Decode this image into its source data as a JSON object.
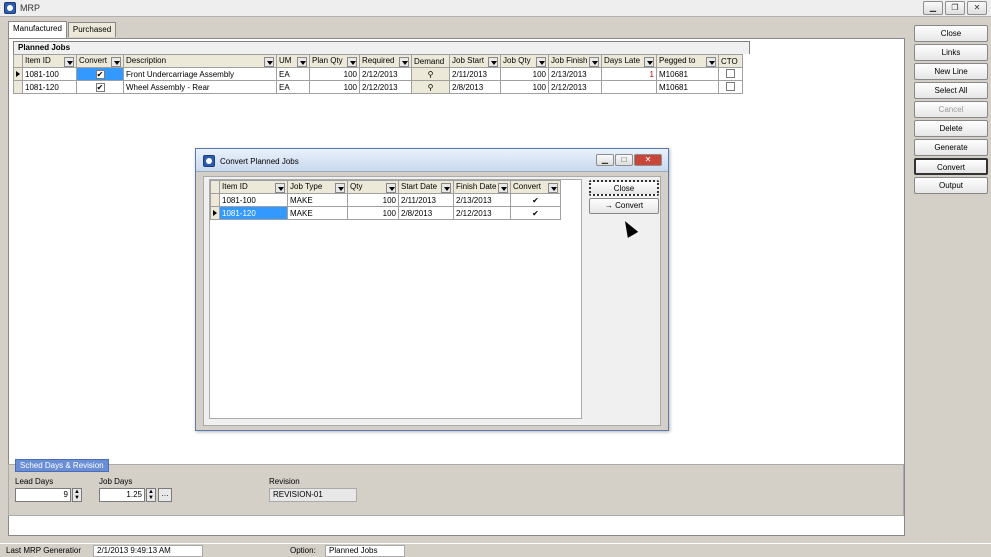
{
  "window": {
    "title": "MRP"
  },
  "tabs": [
    "Manufactured",
    "Purchased"
  ],
  "grid": {
    "title": "Planned Jobs",
    "columns": [
      "Item ID",
      "Convert",
      "Description",
      "UM",
      "Plan Qty",
      "Required",
      "Demand",
      "Job Start",
      "Job Qty",
      "Job Finish",
      "Days Late",
      "Pegged to",
      "CTO"
    ],
    "rows": [
      {
        "item_id": "1081-100",
        "convert": true,
        "description": "Front Undercarriage Assembly",
        "um": "EA",
        "plan_qty": "100",
        "required": "2/12/2013",
        "job_start": "2/11/2013",
        "job_qty": "100",
        "job_finish": "2/13/2013",
        "days_late": "1",
        "pegged_to": "M10681",
        "cto": false
      },
      {
        "item_id": "1081-120",
        "convert": true,
        "description": "Wheel Assembly - Rear",
        "um": "EA",
        "plan_qty": "100",
        "required": "2/12/2013",
        "job_start": "2/8/2013",
        "job_qty": "100",
        "job_finish": "2/12/2013",
        "days_late": "",
        "pegged_to": "M10681",
        "cto": false
      }
    ]
  },
  "sidebar": {
    "close": "Close",
    "links": "Links",
    "new_line": "New Line",
    "select_all": "Select All",
    "cancel": "Cancel",
    "delete": "Delete",
    "generate": "Generate",
    "convert": "Convert",
    "output": "Output"
  },
  "sched": {
    "tab": "Sched Days & Revision",
    "lead_days_label": "Lead Days",
    "lead_days": "9",
    "job_days_label": "Job Days",
    "job_days": "1.25",
    "revision_label": "Revision",
    "revision": "REVISION-01"
  },
  "status": {
    "last_mrp_label": "Last MRP Generatior",
    "last_mrp": "2/1/2013 9:49:13 AM",
    "option_label": "Option:",
    "option": "Planned Jobs"
  },
  "dialog": {
    "title": "Convert Planned Jobs",
    "columns": [
      "Item ID",
      "Job Type",
      "Qty",
      "Start Date",
      "Finish Date",
      "Convert"
    ],
    "rows": [
      {
        "item_id": "1081-100",
        "job_type": "MAKE",
        "qty": "100",
        "start": "2/11/2013",
        "finish": "2/13/2013",
        "convert": true
      },
      {
        "item_id": "1081-120",
        "job_type": "MAKE",
        "qty": "100",
        "start": "2/8/2013",
        "finish": "2/12/2013",
        "convert": true
      }
    ],
    "close": "Close",
    "convert": "→ Convert"
  }
}
